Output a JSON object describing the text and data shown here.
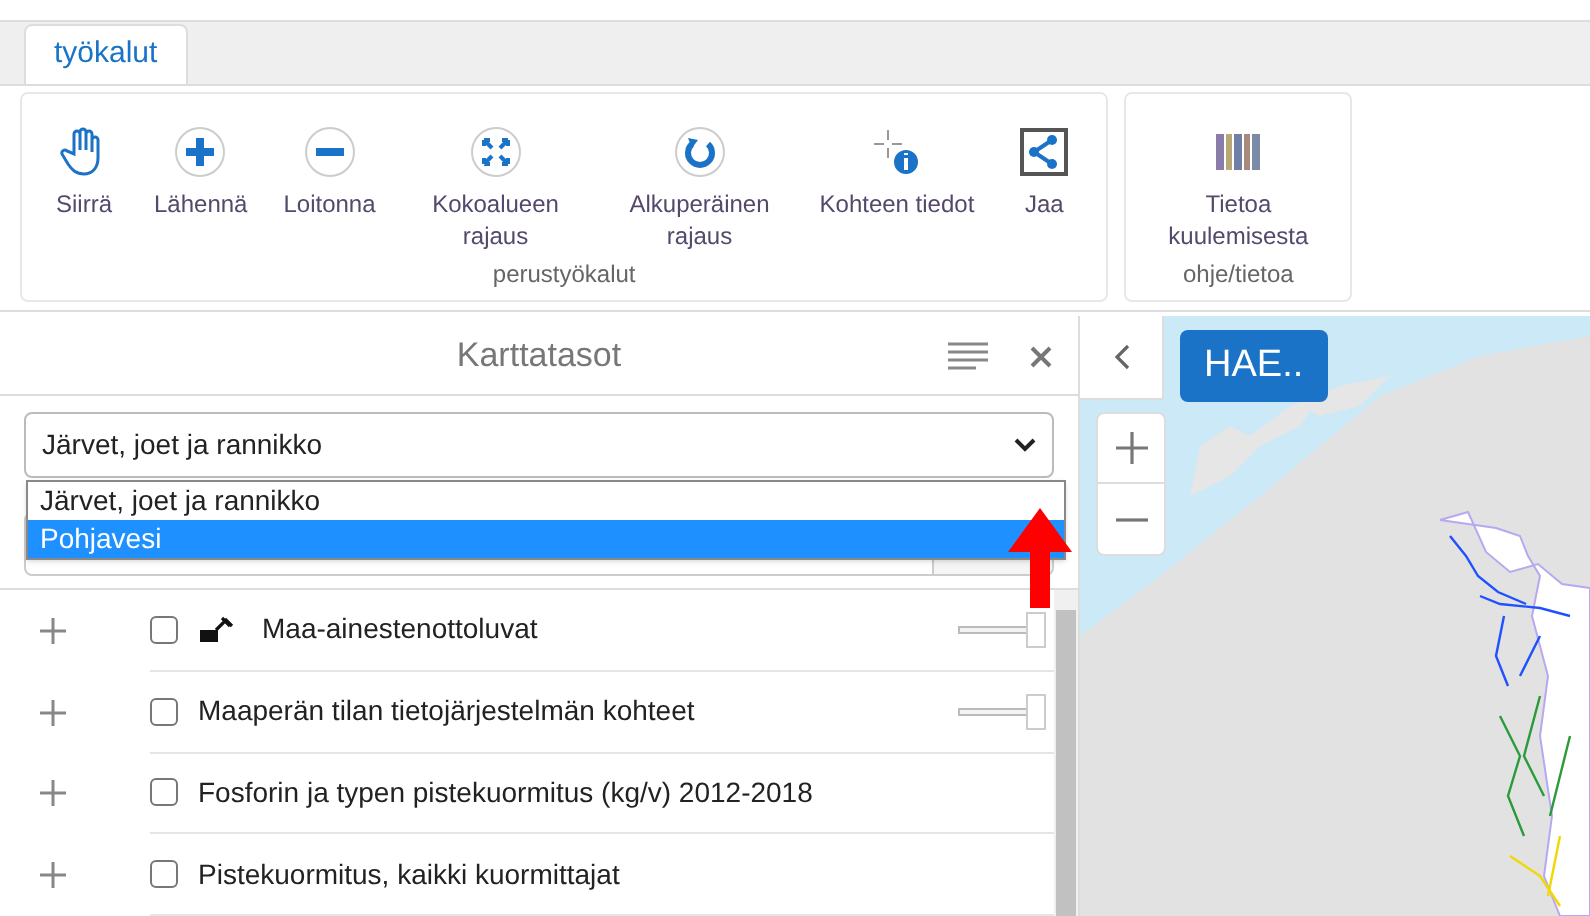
{
  "tabs": [
    {
      "label": "työkalut",
      "selected": true
    }
  ],
  "tool_groups": [
    {
      "caption": "perustyökalut",
      "tools": [
        {
          "kind": "hand",
          "label": "Siirrä"
        },
        {
          "kind": "plus",
          "label": "Lähennä"
        },
        {
          "kind": "minus",
          "label": "Loitonna"
        },
        {
          "kind": "extent",
          "label": "Kokoalueen rajaus"
        },
        {
          "kind": "reset",
          "label": "Alkuperäinen rajaus"
        },
        {
          "kind": "info",
          "label": "Kohteen tiedot"
        },
        {
          "kind": "share",
          "label": "Jaa"
        }
      ]
    },
    {
      "caption": "ohje/tietoa",
      "tools": [
        {
          "kind": "book",
          "label": "Tietoa kuulemisesta"
        }
      ]
    }
  ],
  "layers_panel": {
    "title": "Karttatasot",
    "select": {
      "value": "Järvet, joet ja rannikko",
      "options": [
        {
          "label": "Järvet, joet ja rannikko",
          "highlighted": false
        },
        {
          "label": "Pohjavesi",
          "highlighted": true
        }
      ]
    },
    "layers": [
      {
        "name": "Maa-ainestenottoluvat",
        "checked": false,
        "has_icon": true,
        "opacity": {
          "level": 1
        }
      },
      {
        "name": "Maaperän tilan tietojärjestelmän kohteet",
        "checked": false,
        "has_icon": false,
        "opacity": {
          "level": 1
        }
      },
      {
        "name": "Fosforin ja typen pistekuormitus (kg/v) 2012-2018",
        "checked": false,
        "has_icon": false
      },
      {
        "name": "Pistekuormitus, kaikki kuormittajat",
        "checked": false,
        "has_icon": false
      }
    ]
  },
  "map": {
    "search_button": "HAE.."
  }
}
